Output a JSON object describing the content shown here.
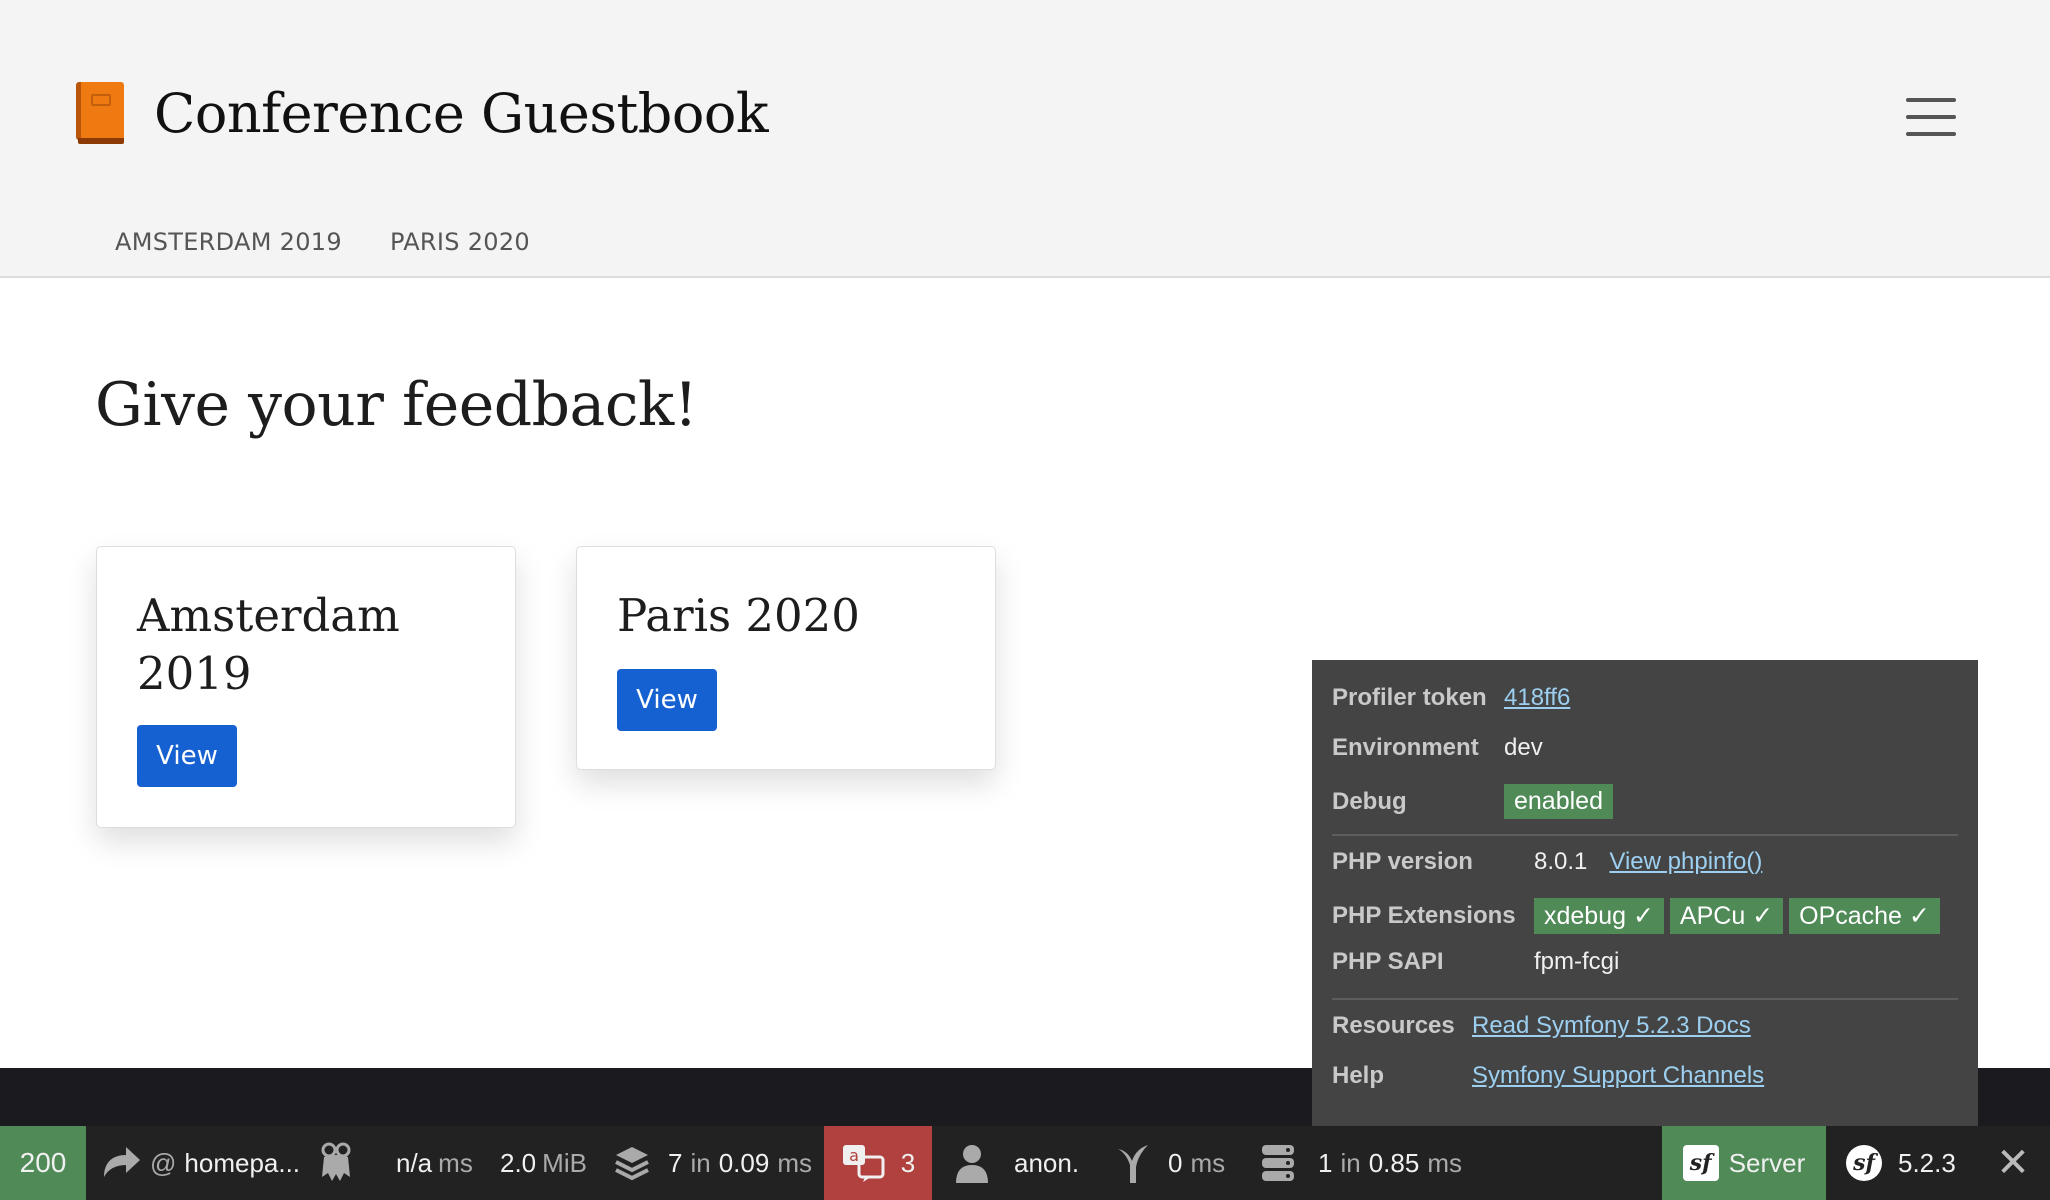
{
  "header": {
    "brand_title": "Conference Guestbook",
    "menu_icon": "hamburger-menu-icon",
    "nav": [
      "AMSTERDAM 2019",
      "PARIS 2020"
    ]
  },
  "main": {
    "title": "Give your feedback!",
    "cards": [
      {
        "title": "Amsterdam 2019",
        "button": "View"
      },
      {
        "title": "Paris 2020",
        "button": "View"
      }
    ]
  },
  "profiler_popup": {
    "token_label": "Profiler token",
    "token_value": "418ff6",
    "env_label": "Environment",
    "env_value": "dev",
    "debug_label": "Debug",
    "debug_value": "enabled",
    "php_version_label": "PHP version",
    "php_version_value": "8.0.1",
    "phpinfo_link": "View phpinfo()",
    "php_ext_label": "PHP Extensions",
    "php_ext": [
      "xdebug ✓",
      "APCu ✓",
      "OPcache ✓"
    ],
    "php_sapi_label": "PHP SAPI",
    "php_sapi_value": "fpm-fcgi",
    "resources_label": "Resources",
    "resources_link": "Read Symfony 5.2.3 Docs",
    "help_label": "Help",
    "help_link": "Symfony Support Channels"
  },
  "toolbar": {
    "status_code": "200",
    "route_at": "@",
    "route": "homepa...",
    "time_value": "n/a",
    "time_unit": "ms",
    "memory_value": "2.0",
    "memory_unit": "MiB",
    "templates_count": "7",
    "templates_in": "in",
    "templates_time": "0.09",
    "templates_unit": "ms",
    "translation_count": "3",
    "user": "anon.",
    "events_value": "0",
    "events_unit": "ms",
    "db_count": "1",
    "db_in": "in",
    "db_time": "0.85",
    "db_unit": "ms",
    "server_label": "Server",
    "symfony_version": "5.2.3",
    "colors": {
      "success": "#4f8a57",
      "error": "#b0413e",
      "link": "#9ccff0"
    }
  }
}
